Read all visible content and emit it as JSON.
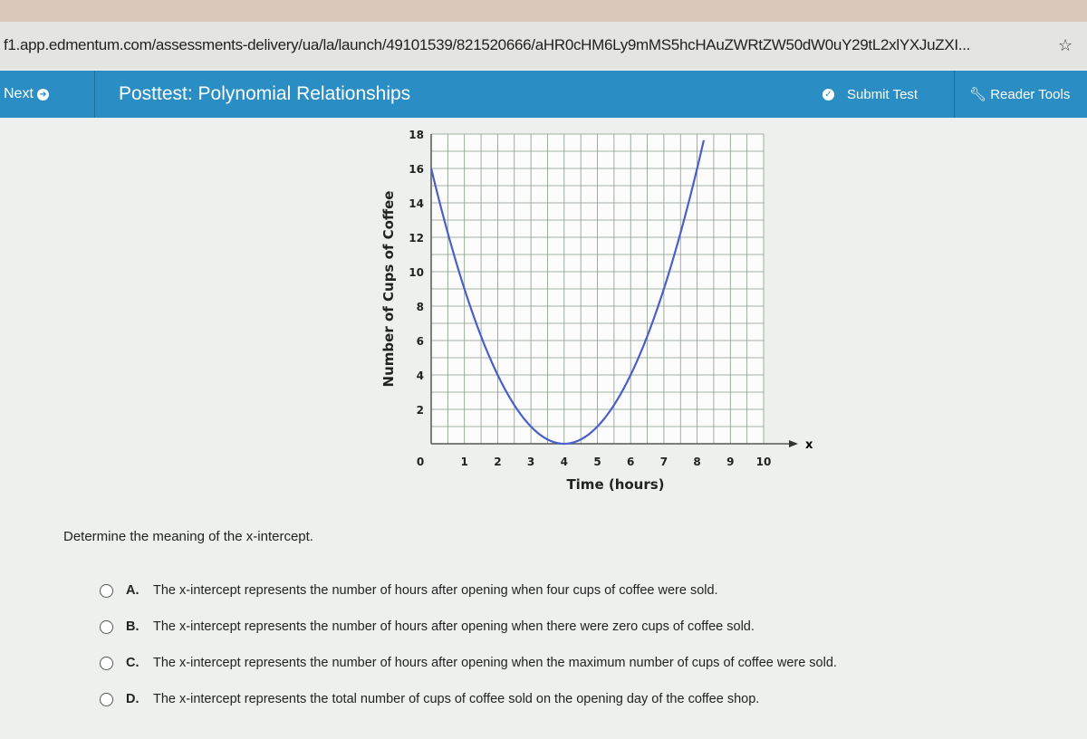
{
  "browser": {
    "url": "f1.app.edmentum.com/assessments-delivery/ua/la/launch/49101539/821520666/aHR0cHM6Ly9mMS5hcHAuZWRtZW50dW0uY29tL2xlYXJuZXI...",
    "star_icon": "star-icon"
  },
  "header": {
    "next_label": "Next",
    "title": "Posttest: Polynomial Relationships",
    "submit_label": "Submit Test",
    "reader_label": "Reader Tools",
    "accent": "#2a8ec4"
  },
  "chart_data": {
    "type": "line",
    "title": "",
    "xlabel": "Time (hours)",
    "ylabel": "Number of Cups of Coffee",
    "xlim": [
      0,
      10
    ],
    "ylim": [
      0,
      18
    ],
    "grid": true,
    "axis_arrow_label": "x",
    "xticks": [
      "0",
      "1",
      "2",
      "3",
      "4",
      "5",
      "6",
      "7",
      "8",
      "9",
      "10"
    ],
    "yticks": [
      "2",
      "4",
      "6",
      "8",
      "10",
      "12",
      "14",
      "16",
      "18"
    ],
    "series": [
      {
        "color": "#4a5fc8",
        "x": [
          0,
          1,
          2,
          3,
          4,
          5,
          6,
          7,
          8
        ],
        "y": [
          16,
          9,
          4,
          1,
          0,
          1,
          4,
          9,
          16
        ]
      }
    ]
  },
  "question": {
    "prompt": "Determine the meaning of the x-intercept.",
    "options": [
      {
        "letter": "A.",
        "text": "The x-intercept represents the number of hours after opening when four cups of coffee were sold."
      },
      {
        "letter": "B.",
        "text": "The x-intercept represents the number of hours after opening when there were zero cups of coffee sold."
      },
      {
        "letter": "C.",
        "text": "The x-intercept represents the number of hours after opening when the maximum number of cups of coffee were sold."
      },
      {
        "letter": "D.",
        "text": "The x-intercept represents the total number of cups of coffee sold on the opening day of the coffee shop."
      }
    ]
  }
}
